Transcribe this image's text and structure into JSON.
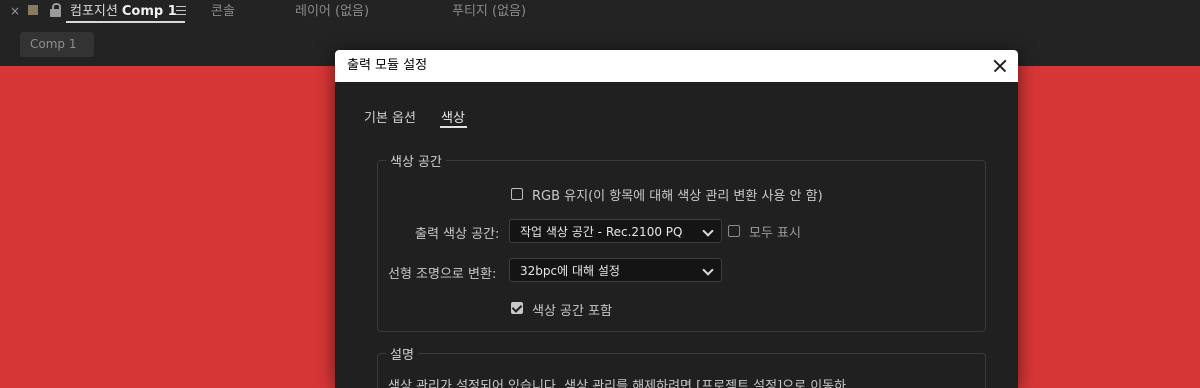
{
  "top_tabs": {
    "composition_prefix": "컴포지션",
    "composition_name": "Comp 1",
    "console": "콘솔",
    "layer": "레이어 (없음)",
    "footage": "푸티지 (없음)"
  },
  "comp_chip": "Comp 1",
  "canvas_color": "#d73636",
  "dialog": {
    "title": "출력 모듈 설정",
    "tabs": [
      {
        "label": "기본 옵션",
        "active": false
      },
      {
        "label": "색상",
        "active": true
      }
    ],
    "color_space_group": {
      "legend": "색상 공간",
      "preserve_rgb": {
        "label": "RGB 유지(이 항목에 대해 색상 관리 변환 사용 안 함)",
        "checked": false
      },
      "output_color_space": {
        "label": "출력 색상 공간:",
        "value": "작업 색상 공간 - Rec.2100 PQ"
      },
      "show_all": {
        "label": "모두 표시",
        "checked": false
      },
      "linearize": {
        "label": "선형 조명으로 변환:",
        "value": "32bpc에 대해 설정"
      },
      "embed_profile": {
        "label": "색상 공간 포함",
        "checked": true
      }
    },
    "description_group": {
      "legend": "설명",
      "text": "색상 관리가 설정되어 있습니다. 색상 관리를 해제하려면 [프로젝트 설정]으로 이동하"
    }
  }
}
